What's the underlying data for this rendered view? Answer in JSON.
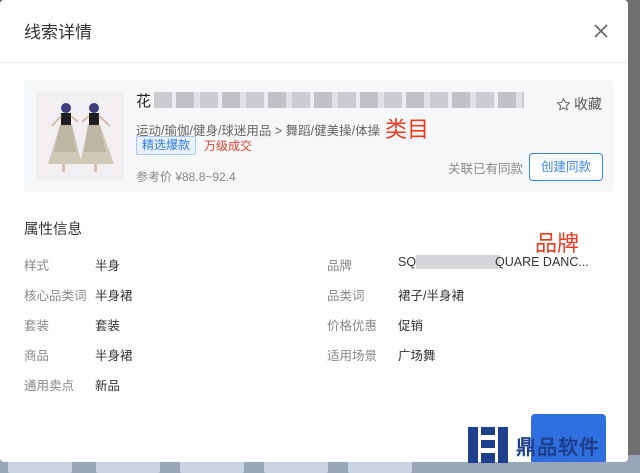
{
  "modal": {
    "title": "线索详情"
  },
  "product": {
    "title_prefix": "花",
    "favorite_label": "收藏",
    "category_path": "运动/瑜伽/健身/球迷用品 > 舞蹈/健美操/体操",
    "tag_selected": "精选爆款",
    "tag_sales": "万级成交",
    "price_label": "参考价 ¥88.8~92.4",
    "linked_label": "关联已有同款",
    "create_button": "创建同款"
  },
  "annotations": {
    "category_note": "类目",
    "brand_note": "品牌"
  },
  "attributes": {
    "section_title": "属性信息",
    "left": [
      {
        "label": "样式",
        "value": "半身"
      },
      {
        "label": "核心品类词",
        "value": "半身裙"
      },
      {
        "label": "套装",
        "value": "套装"
      },
      {
        "label": "商品",
        "value": "半身裙"
      },
      {
        "label": "通用卖点",
        "value": "新品"
      }
    ],
    "right": [
      {
        "label": "品牌",
        "value_prefix": "SQ",
        "value_suffix": "QUARE DANC..."
      },
      {
        "label": "品类词",
        "value": "裙子/半身裙"
      },
      {
        "label": "价格优惠",
        "value": "促销"
      },
      {
        "label": "适用场景",
        "value": "广场舞"
      }
    ]
  },
  "watermark": {
    "text": "鼎品软件"
  },
  "colors": {
    "accent_blue": "#3a86e8",
    "annotation_red": "#f0391e",
    "tag_red": "#e3452f",
    "watermark_blue": "#1d3f8c"
  }
}
